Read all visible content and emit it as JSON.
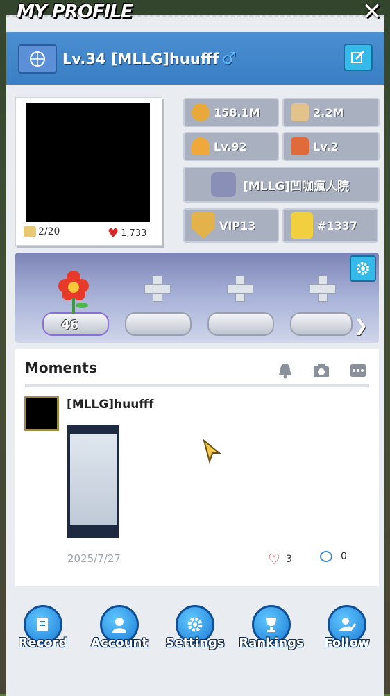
{
  "title": "MY PROFILE",
  "player": {
    "level_name": "Lv.34 [MLLG]huufff",
    "gender_symbol": "♂"
  },
  "avatar": {
    "photos": "2/20",
    "likes": "1,733"
  },
  "stats": {
    "power": "158.1M",
    "kills": "2.2M",
    "hero_level": "Lv.92",
    "gift_level": "Lv.2",
    "alliance": "[MLLG]凹咖瘋人院",
    "vip": "VIP13",
    "rank": "#1337"
  },
  "showcase": {
    "flower_count": "46"
  },
  "moments": {
    "title": "Moments",
    "post": {
      "author": "[MLLG]huufff",
      "date": "2025/7/27",
      "likes": "3",
      "comments": "0"
    }
  },
  "nav": [
    {
      "label": "Record",
      "icon": "record-icon"
    },
    {
      "label": "Account",
      "icon": "account-icon"
    },
    {
      "label": "Settings",
      "icon": "settings-icon"
    },
    {
      "label": "Rankings",
      "icon": "rankings-icon"
    },
    {
      "label": "Follow",
      "icon": "follow-icon"
    }
  ],
  "colors": {
    "header": "#3a7fc4",
    "accent": "#35b9e8",
    "nav": "#1f7ed6"
  }
}
